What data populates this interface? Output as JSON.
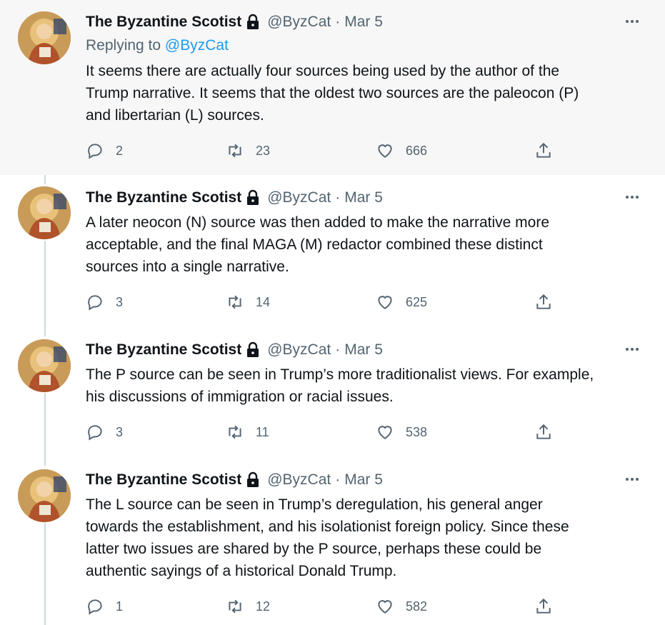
{
  "tweets": [
    {
      "author": "The Byzantine Scotist",
      "handle": "@ByzCat",
      "separator": "·",
      "date": "Mar 5",
      "replying_prefix": "Replying to",
      "replying_to": "@ByzCat",
      "text": "It seems there are actually four sources being used by the author of the\nTrump narrative. It seems that the oldest two sources are the paleocon (P)\nand libertarian (L) sources.",
      "replies": "2",
      "retweets": "23",
      "likes": "666"
    },
    {
      "author": "The Byzantine Scotist",
      "handle": "@ByzCat",
      "separator": "·",
      "date": "Mar 5",
      "text": "A later neocon (N) source was then added to make the narrative more\nacceptable, and the final MAGA (M) redactor combined these distinct\nsources into a single narrative.",
      "replies": "3",
      "retweets": "14",
      "likes": "625"
    },
    {
      "author": "The Byzantine Scotist",
      "handle": "@ByzCat",
      "separator": "·",
      "date": "Mar 5",
      "text": "The P source can be seen in Trump’s more traditionalist views. For example,\nhis discussions of immigration or racial issues.",
      "replies": "3",
      "retweets": "11",
      "likes": "538"
    },
    {
      "author": "The Byzantine Scotist",
      "handle": "@ByzCat",
      "separator": "·",
      "date": "Mar 5",
      "text": "The L source can be seen in Trump’s deregulation, his general anger\ntowards the establishment, and his isolationist foreign policy. Since these\nlatter two issues are shared by the P source, perhaps these could be\nauthentic sayings of a historical Donald Trump.",
      "replies": "1",
      "retweets": "12",
      "likes": "582"
    }
  ],
  "icons": {
    "avatar": "monk-avatar-icon",
    "protected": "lock-icon",
    "more": "more-options-icon",
    "reply": "reply-icon",
    "retweet": "retweet-icon",
    "like": "heart-icon",
    "share": "share-icon"
  },
  "colors": {
    "link": "#1d9bf0",
    "secondary_text": "#536471",
    "highlight_bg": "#f7f7f7",
    "thread_line": "#cfd9de"
  }
}
